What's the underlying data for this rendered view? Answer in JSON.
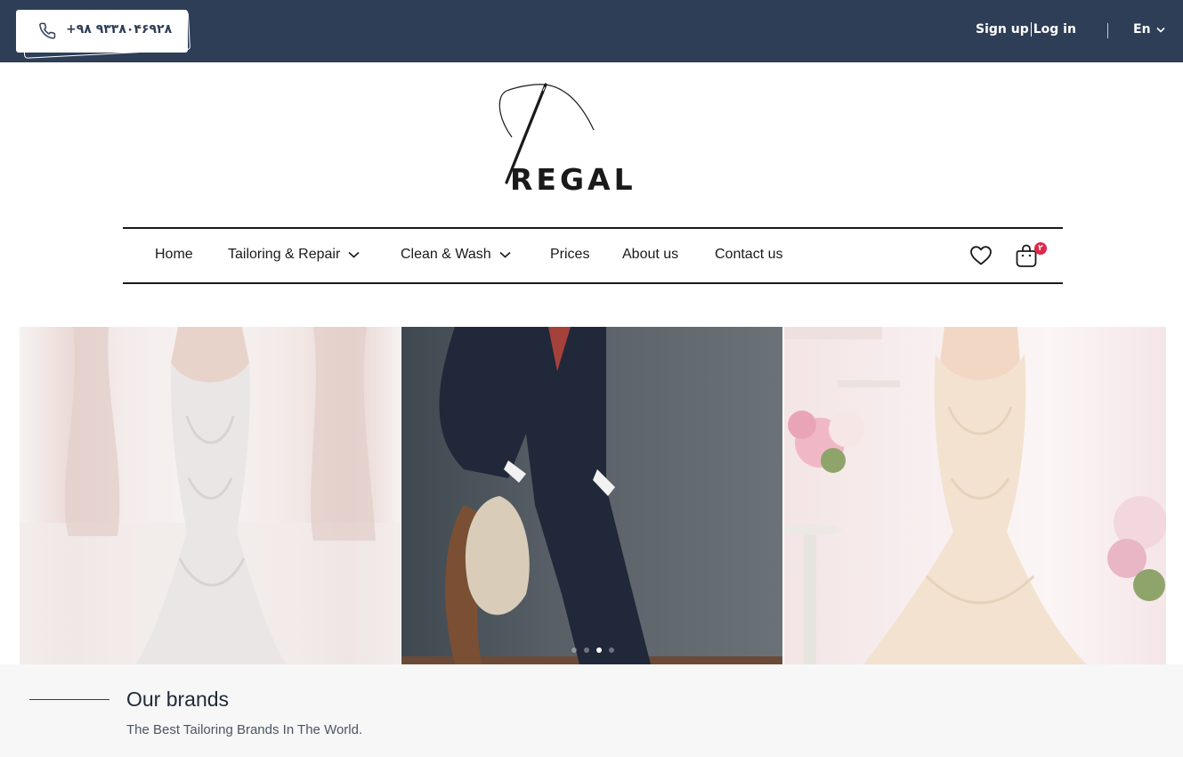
{
  "topbar": {
    "phone": "+۹۸ ۹۳۳۸۰۴۶۹۲۸",
    "signup_label": "Sign up",
    "login_label": "Log in",
    "language": "En"
  },
  "logo": {
    "text": "REGAL"
  },
  "nav": {
    "items": [
      {
        "label": "Home"
      },
      {
        "label": "Tailoring & Repair"
      },
      {
        "label": "Clean & Wash"
      },
      {
        "label": "Prices"
      },
      {
        "label": "About us"
      },
      {
        "label": "Contact us"
      }
    ],
    "cart_count": "۲"
  },
  "carousel": {
    "slide_count": 4,
    "active_index": 2
  },
  "brands": {
    "title": "Our brands",
    "subtitle": "The Best Tailoring Brands In The World."
  },
  "colors": {
    "topbar_bg": "#2e3e57",
    "badge": "#e0294a",
    "section_bg": "#f7f7f7"
  }
}
